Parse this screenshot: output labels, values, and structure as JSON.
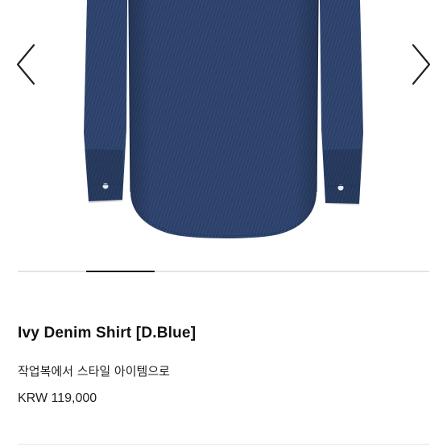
{
  "gallery": {
    "image": {
      "alt": "Ivy Denim Shirt [D.Blue]",
      "color": "#2b3f66"
    },
    "prev_icon": "chevron-left-icon",
    "next_icon": "chevron-right-icon",
    "slide_count": 6,
    "active_slide": 2
  },
  "product": {
    "title": "Ivy Denim Shirt [D.Blue]",
    "subtitle": "작업복에서 스타일 아이템으로",
    "price": "KRW 119,000"
  }
}
